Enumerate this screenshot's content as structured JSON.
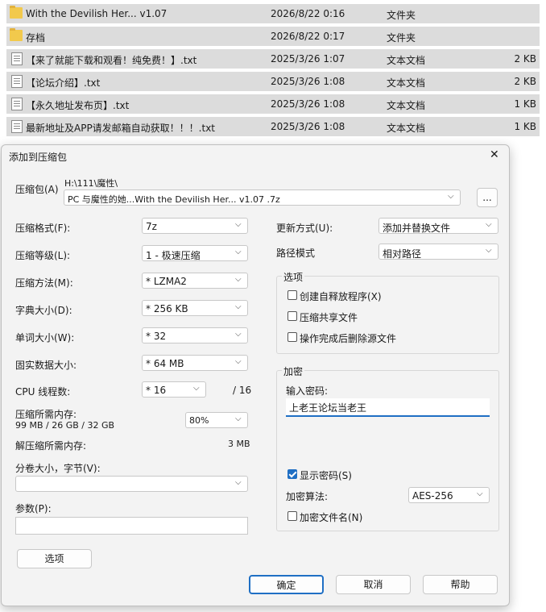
{
  "files": [
    {
      "name": "With the Devilish Her... v1.07",
      "date": "2026/8/22 0:16",
      "type": "文件夹",
      "size": "",
      "icon": "folder-icon"
    },
    {
      "name": "存档",
      "date": "2026/8/22 0:17",
      "type": "文件夹",
      "size": "",
      "icon": "folder-icon"
    },
    {
      "name": "【来了就能下载和观看！纯免费！】.txt",
      "date": "2025/3/26 1:07",
      "type": "文本文档",
      "size": "2 KB",
      "icon": "text-file-icon"
    },
    {
      "name": "【论坛介绍】.txt",
      "date": "2025/3/26 1:08",
      "type": "文本文档",
      "size": "2 KB",
      "icon": "text-file-icon"
    },
    {
      "name": "【永久地址发布页】.txt",
      "date": "2025/3/26 1:08",
      "type": "文本文档",
      "size": "1 KB",
      "icon": "text-file-icon"
    },
    {
      "name": "最新地址及APP请发邮箱自动获取！！！.txt",
      "date": "2025/3/26 1:08",
      "type": "文本文档",
      "size": "1 KB",
      "icon": "text-file-icon"
    }
  ],
  "dialog": {
    "title": "添加到压缩包",
    "close": "✕",
    "archive_label": "压缩包(A)",
    "archive_path": "H:\\111\\魔性\\",
    "archive_name": "PC 与魔性的她...With the Devilish Her... v1.07 .7z",
    "browse": "...",
    "format_label": "压缩格式(F):",
    "format_value": "7z",
    "level_label": "压缩等级(L):",
    "level_value": "1 - 极速压缩",
    "method_label": "压缩方法(M):",
    "method_value": "*  LZMA2",
    "dict_label": "字典大小(D):",
    "dict_value": "*  256 KB",
    "word_label": "单词大小(W):",
    "word_value": "*  32",
    "solid_label": "固实数据大小:",
    "solid_value": "*  64 MB",
    "cpu_label": "CPU 线程数:",
    "cpu_value": "*  16",
    "cpu_total": "/ 16",
    "mem_label": "压缩所需内存:",
    "mem_detail": "99 MB / 26 GB / 32 GB",
    "mem_percent": "80%",
    "decomp_label": "解压缩所需内存:",
    "decomp_value": "3 MB",
    "volume_label": "分卷大小，字节(V):",
    "volume_value": "",
    "params_label": "参数(P):",
    "params_value": "",
    "options_button": "选项",
    "update_label": "更新方式(U):",
    "update_value": "添加并替换文件",
    "path_label": "路径模式",
    "path_value": "相对路径",
    "options_group": "选项",
    "opt_sfx": "创建自释放程序(X)",
    "opt_shared": "压缩共享文件",
    "opt_delete": "操作完成后删除源文件",
    "encrypt_group": "加密",
    "password_label": "输入密码:",
    "password_value": "上老王论坛当老王",
    "show_password": "显示密码(S)",
    "enc_method_label": "加密算法:",
    "enc_method_value": "AES-256",
    "encrypt_names": "加密文件名(N)",
    "ok": "确定",
    "cancel": "取消",
    "help": "帮助"
  }
}
